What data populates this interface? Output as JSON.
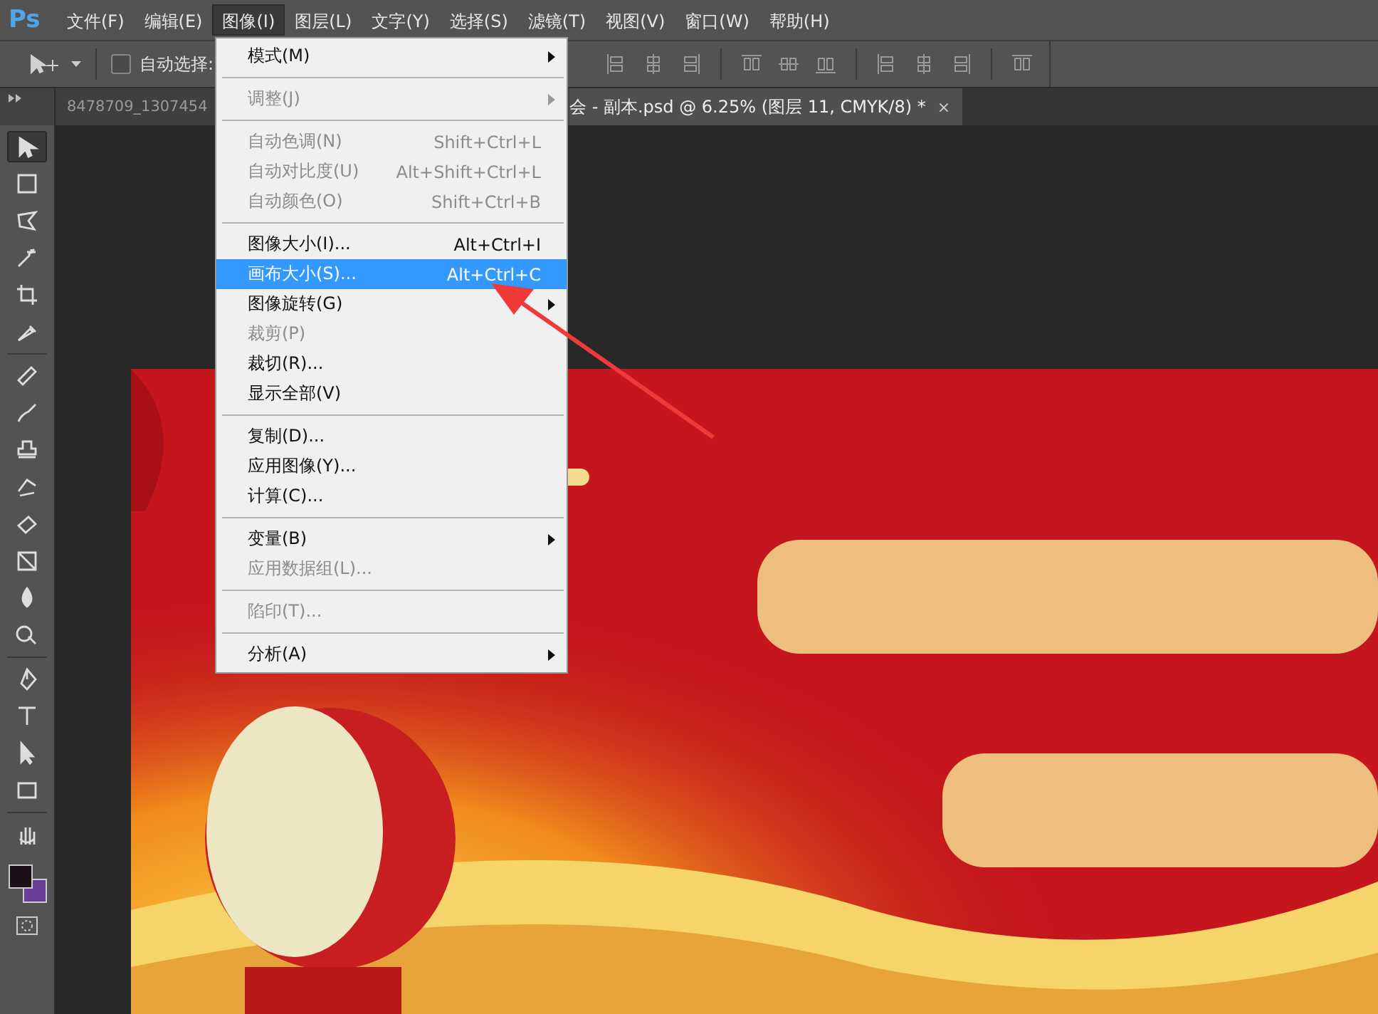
{
  "app_logo": "Ps",
  "menu_bar": [
    {
      "label": "文件(F)",
      "selected": false
    },
    {
      "label": "编辑(E)",
      "selected": false
    },
    {
      "label": "图像(I)",
      "selected": true
    },
    {
      "label": "图层(L)",
      "selected": false
    },
    {
      "label": "文字(Y)",
      "selected": false
    },
    {
      "label": "选择(S)",
      "selected": false
    },
    {
      "label": "滤镜(T)",
      "selected": false
    },
    {
      "label": "视图(V)",
      "selected": false
    },
    {
      "label": "窗口(W)",
      "selected": false
    },
    {
      "label": "帮助(H)",
      "selected": false
    }
  ],
  "options_bar": {
    "auto_select": {
      "label": "自动选择:",
      "checked": false
    }
  },
  "document_tabs": [
    {
      "label": "8478709_1307454",
      "selected": false
    },
    {
      "label": "会 - 副本.psd @ 6.25% (图层 11, CMYK/8) *",
      "close": "×",
      "selected": true
    }
  ],
  "tools": [
    {
      "selected": true
    },
    {
      "selected": false
    },
    {
      "selected": false
    },
    {
      "selected": false
    },
    {
      "selected": false
    },
    {
      "selected": false
    },
    {
      "selected": false
    },
    {
      "selected": false
    },
    {
      "selected": false
    },
    {
      "selected": false
    },
    {
      "selected": false
    },
    {
      "selected": false
    },
    {
      "selected": false
    },
    {
      "selected": false
    },
    {
      "selected": false
    },
    {
      "selected": false
    },
    {
      "selected": false
    },
    {
      "selected": false
    },
    {
      "selected": false
    }
  ],
  "image_menu": [
    {
      "kind": "item",
      "label": "模式(M)",
      "submenu": true,
      "disabled": false,
      "selected": false
    },
    {
      "kind": "separator"
    },
    {
      "kind": "item",
      "label": "调整(J)",
      "submenu": true,
      "disabled": true,
      "selected": false
    },
    {
      "kind": "separator"
    },
    {
      "kind": "item",
      "label": "自动色调(N)",
      "shortcut": "Shift+Ctrl+L",
      "disabled": true,
      "selected": false
    },
    {
      "kind": "item",
      "label": "自动对比度(U)",
      "shortcut": "Alt+Shift+Ctrl+L",
      "disabled": true,
      "selected": false
    },
    {
      "kind": "item",
      "label": "自动颜色(O)",
      "shortcut": "Shift+Ctrl+B",
      "disabled": true,
      "selected": false
    },
    {
      "kind": "separator"
    },
    {
      "kind": "item",
      "label": "图像大小(I)...",
      "shortcut": "Alt+Ctrl+I",
      "disabled": false,
      "selected": false
    },
    {
      "kind": "item",
      "label": "画布大小(S)...",
      "shortcut": "Alt+Ctrl+C",
      "disabled": false,
      "selected": true
    },
    {
      "kind": "item",
      "label": "图像旋转(G)",
      "submenu": true,
      "disabled": false,
      "selected": false
    },
    {
      "kind": "item",
      "label": "裁剪(P)",
      "disabled": true,
      "selected": false
    },
    {
      "kind": "item",
      "label": "裁切(R)...",
      "disabled": false,
      "selected": false
    },
    {
      "kind": "item",
      "label": "显示全部(V)",
      "disabled": false,
      "selected": false
    },
    {
      "kind": "separator"
    },
    {
      "kind": "item",
      "label": "复制(D)...",
      "disabled": false,
      "selected": false
    },
    {
      "kind": "item",
      "label": "应用图像(Y)...",
      "disabled": false,
      "selected": false
    },
    {
      "kind": "item",
      "label": "计算(C)...",
      "disabled": false,
      "selected": false
    },
    {
      "kind": "separator"
    },
    {
      "kind": "item",
      "label": "变量(B)",
      "submenu": true,
      "disabled": false,
      "selected": false
    },
    {
      "kind": "item",
      "label": "应用数据组(L)...",
      "disabled": true,
      "selected": false
    },
    {
      "kind": "separator"
    },
    {
      "kind": "item",
      "label": "陷印(T)...",
      "disabled": true,
      "selected": false
    },
    {
      "kind": "separator"
    },
    {
      "kind": "item",
      "label": "分析(A)",
      "submenu": true,
      "disabled": false,
      "selected": false
    }
  ]
}
